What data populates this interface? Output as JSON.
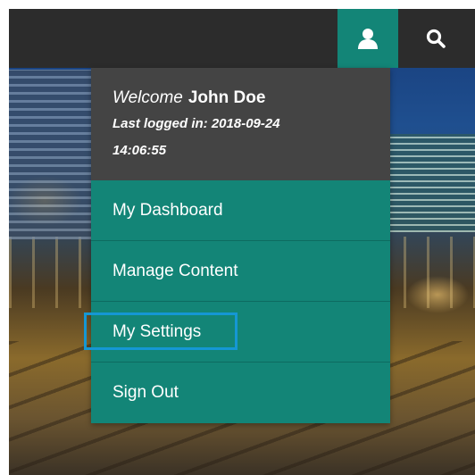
{
  "topbar": {
    "user_icon": "user-icon",
    "search_icon": "search-icon"
  },
  "dropdown": {
    "welcome_word": "Welcome",
    "user_name": "John Doe",
    "last_login_label": "Last logged in:",
    "last_login_value": "2018-09-24 14:06:55",
    "items": [
      {
        "label": "My Dashboard"
      },
      {
        "label": "Manage Content"
      },
      {
        "label": "My Settings"
      },
      {
        "label": "Sign Out"
      }
    ]
  },
  "colors": {
    "accent": "#138577",
    "topbar": "#2c2c2c",
    "header": "#444444",
    "focus_ring": "#1597d4"
  }
}
